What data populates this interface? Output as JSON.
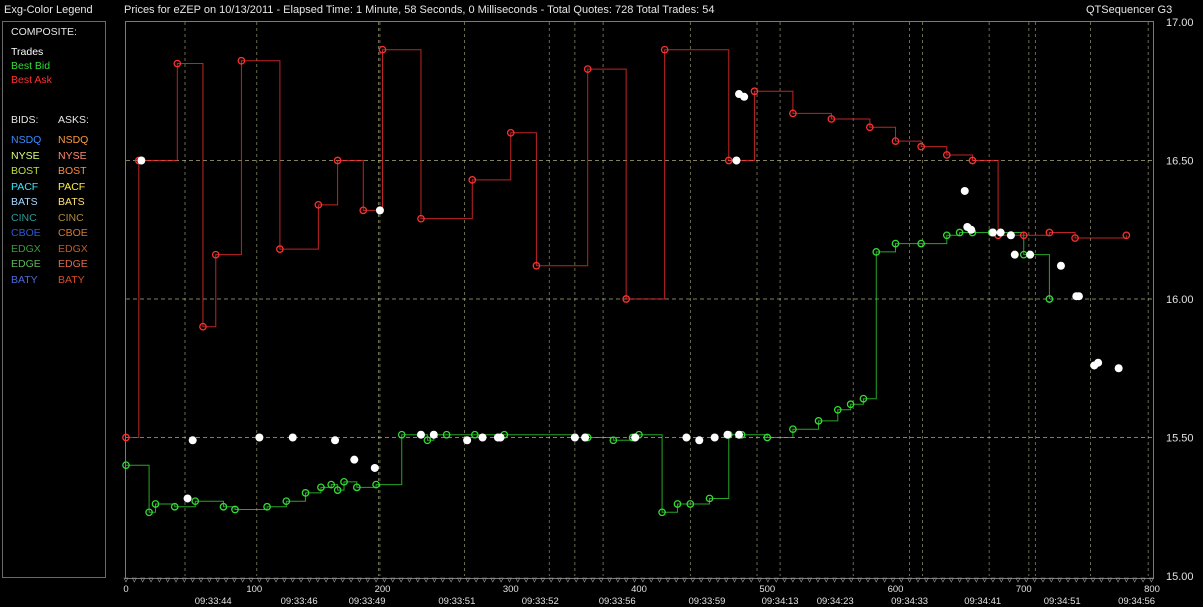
{
  "header": {
    "legend_title": "Exg-Color Legend",
    "chart_title": "Prices for  eZEP  on  10/13/2011  -  Elapsed Time: 1 Minute, 58 Seconds, 0 Milliseconds  -  Total Quotes: 728  Total Trades: 54",
    "app_name": "QTSequencer G3"
  },
  "legend": {
    "composite_label": "COMPOSITE:",
    "composite": [
      {
        "label": "Trades",
        "color": "#ffffff"
      },
      {
        "label": "Best Bid",
        "color": "#33dd33"
      },
      {
        "label": "Best Ask",
        "color": "#ff3030"
      }
    ],
    "bids_label": "BIDS:",
    "asks_label": "ASKS:",
    "exchanges": [
      {
        "bid": "NSDQ",
        "ask": "NSDQ",
        "bid_color": "#3a8cff",
        "ask_color": "#ff9a3a"
      },
      {
        "bid": "NYSE",
        "ask": "NYSE",
        "bid_color": "#d8ff7a",
        "ask_color": "#ff8a70"
      },
      {
        "bid": "BOST",
        "ask": "BOST",
        "bid_color": "#b8e23a",
        "ask_color": "#ff8a3a"
      },
      {
        "bid": "PACF",
        "ask": "PACF",
        "bid_color": "#3ae6ff",
        "ask_color": "#ffee3a"
      },
      {
        "bid": "BATS",
        "ask": "BATS",
        "bid_color": "#a8d8ff",
        "ask_color": "#ffe070"
      },
      {
        "bid": "CINC",
        "ask": "CINC",
        "bid_color": "#2a9a9a",
        "ask_color": "#b08a3a"
      },
      {
        "bid": "CBOE",
        "ask": "CBOE",
        "bid_color": "#2a5ad8",
        "ask_color": "#d87a2a"
      },
      {
        "bid": "EDGX",
        "ask": "EDGX",
        "bid_color": "#3a9a3a",
        "ask_color": "#c05a2a"
      },
      {
        "bid": "EDGE",
        "ask": "EDGE",
        "bid_color": "#5ab85a",
        "ask_color": "#e06a4a"
      },
      {
        "bid": "BATY",
        "ask": "BATY",
        "bid_color": "#4a6ad8",
        "ask_color": "#d84a2a"
      }
    ]
  },
  "chart_data": {
    "type": "line",
    "title": "Prices for eZEP on 10/13/2011",
    "xlim": [
      0,
      800
    ],
    "ylim": [
      15.0,
      17.0
    ],
    "y_ticks": [
      "15.00",
      "15.50",
      "16.00",
      "16.50",
      "17.00"
    ],
    "x_ticks": [
      0,
      100,
      200,
      300,
      400,
      500,
      600,
      700,
      800
    ],
    "time_labels": [
      {
        "x": 68,
        "label": "09:33:44"
      },
      {
        "x": 135,
        "label": "09:33:46"
      },
      {
        "x": 188,
        "label": "09:33:49"
      },
      {
        "x": 258,
        "label": "09:33:51"
      },
      {
        "x": 323,
        "label": "09:33:52"
      },
      {
        "x": 383,
        "label": "09:33:56"
      },
      {
        "x": 453,
        "label": "09:33:59"
      },
      {
        "x": 510,
        "label": "09:34:13"
      },
      {
        "x": 553,
        "label": "09:34:23"
      },
      {
        "x": 611,
        "label": "09:34:33"
      },
      {
        "x": 668,
        "label": "09:34:41"
      },
      {
        "x": 730,
        "label": "09:34:51"
      },
      {
        "x": 788,
        "label": "09:34:56"
      }
    ],
    "vertical_gridlines_x": [
      46,
      102,
      198,
      197,
      264,
      330,
      350,
      372,
      440,
      492,
      510,
      567,
      611,
      621,
      673,
      704,
      709,
      752,
      797
    ],
    "series": [
      {
        "name": "Trades",
        "color": "#ffffff",
        "points": [
          [
            12,
            16.5
          ],
          [
            52,
            15.49
          ],
          [
            48,
            15.28
          ],
          [
            104,
            15.5
          ],
          [
            130,
            15.5
          ],
          [
            163,
            15.49
          ],
          [
            178,
            15.42
          ],
          [
            194,
            15.39
          ],
          [
            198,
            16.32
          ],
          [
            230,
            15.51
          ],
          [
            240,
            15.51
          ],
          [
            266,
            15.49
          ],
          [
            278,
            15.5
          ],
          [
            290,
            15.5
          ],
          [
            292,
            15.5
          ],
          [
            350,
            15.5
          ],
          [
            358,
            15.5
          ],
          [
            397,
            15.5
          ],
          [
            437,
            15.5
          ],
          [
            447,
            15.49
          ],
          [
            459,
            15.5
          ],
          [
            469,
            15.51
          ],
          [
            478,
            15.51
          ],
          [
            478,
            16.74
          ],
          [
            482,
            16.73
          ],
          [
            476,
            16.5
          ],
          [
            654,
            16.39
          ],
          [
            656,
            16.26
          ],
          [
            659,
            16.25
          ],
          [
            676,
            16.24
          ],
          [
            682,
            16.24
          ],
          [
            690,
            16.23
          ],
          [
            693,
            16.16
          ],
          [
            705,
            16.16
          ],
          [
            729,
            16.12
          ],
          [
            741,
            16.01
          ],
          [
            743,
            16.01
          ],
          [
            755,
            15.76
          ],
          [
            758,
            15.77
          ],
          [
            774,
            15.75
          ]
        ]
      },
      {
        "name": "Best Bid",
        "color": "#33dd33",
        "points": [
          [
            0,
            15.4
          ],
          [
            18,
            15.23
          ],
          [
            23,
            15.26
          ],
          [
            38,
            15.25
          ],
          [
            54,
            15.27
          ],
          [
            76,
            15.25
          ],
          [
            85,
            15.24
          ],
          [
            110,
            15.25
          ],
          [
            125,
            15.27
          ],
          [
            140,
            15.3
          ],
          [
            152,
            15.32
          ],
          [
            160,
            15.33
          ],
          [
            165,
            15.31
          ],
          [
            170,
            15.34
          ],
          [
            180,
            15.32
          ],
          [
            195,
            15.33
          ],
          [
            215,
            15.51
          ],
          [
            235,
            15.49
          ],
          [
            240,
            15.51
          ],
          [
            250,
            15.51
          ],
          [
            272,
            15.51
          ],
          [
            295,
            15.51
          ],
          [
            350,
            15.5
          ],
          [
            360,
            15.5
          ],
          [
            380,
            15.49
          ],
          [
            395,
            15.5
          ],
          [
            400,
            15.51
          ],
          [
            418,
            15.23
          ],
          [
            430,
            15.26
          ],
          [
            440,
            15.26
          ],
          [
            455,
            15.28
          ],
          [
            470,
            15.51
          ],
          [
            480,
            15.51
          ],
          [
            500,
            15.5
          ],
          [
            520,
            15.53
          ],
          [
            540,
            15.56
          ],
          [
            555,
            15.6
          ],
          [
            565,
            15.62
          ],
          [
            575,
            15.64
          ],
          [
            585,
            16.17
          ],
          [
            600,
            16.2
          ],
          [
            620,
            16.2
          ],
          [
            640,
            16.23
          ],
          [
            650,
            16.24
          ],
          [
            660,
            16.24
          ],
          [
            675,
            16.24
          ],
          [
            700,
            16.16
          ],
          [
            720,
            16.0
          ]
        ]
      },
      {
        "name": "Best Ask",
        "color": "#ff3030",
        "points": [
          [
            0,
            15.5
          ],
          [
            10,
            16.5
          ],
          [
            40,
            16.85
          ],
          [
            60,
            15.9
          ],
          [
            70,
            16.16
          ],
          [
            90,
            16.86
          ],
          [
            120,
            16.18
          ],
          [
            150,
            16.34
          ],
          [
            165,
            16.5
          ],
          [
            185,
            16.32
          ],
          [
            200,
            16.9
          ],
          [
            230,
            16.29
          ],
          [
            270,
            16.43
          ],
          [
            300,
            16.6
          ],
          [
            320,
            16.12
          ],
          [
            360,
            16.83
          ],
          [
            390,
            16.0
          ],
          [
            420,
            16.9
          ],
          [
            470,
            16.5
          ],
          [
            490,
            16.75
          ],
          [
            520,
            16.67
          ],
          [
            550,
            16.65
          ],
          [
            580,
            16.62
          ],
          [
            600,
            16.57
          ],
          [
            620,
            16.55
          ],
          [
            640,
            16.52
          ],
          [
            660,
            16.5
          ],
          [
            680,
            16.23
          ],
          [
            700,
            16.23
          ],
          [
            720,
            16.24
          ],
          [
            740,
            16.22
          ],
          [
            780,
            16.23
          ]
        ]
      }
    ]
  }
}
